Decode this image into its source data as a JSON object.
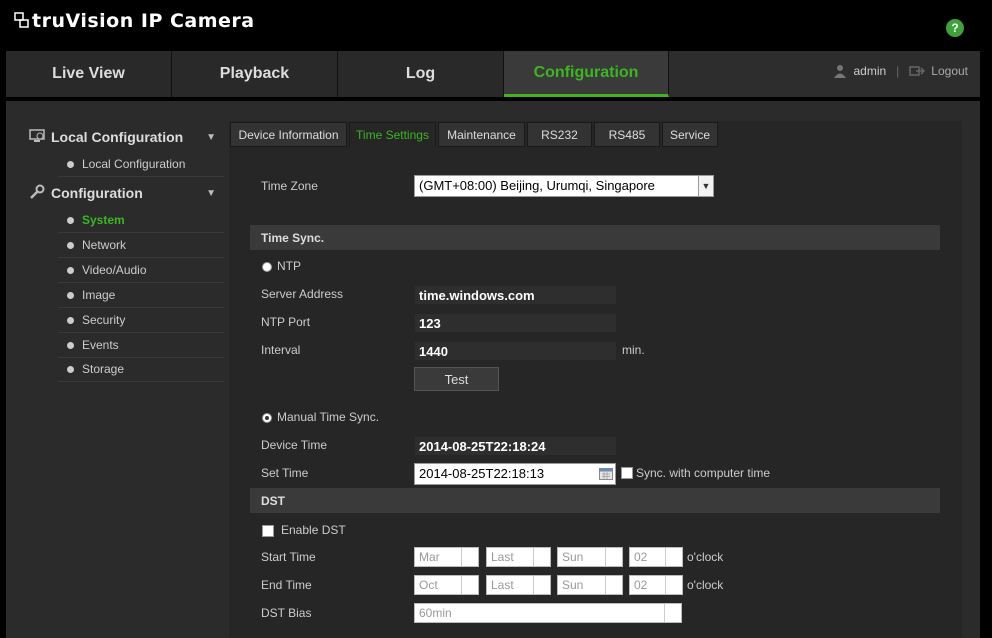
{
  "header": {
    "brand": "truVision  IP Camera",
    "help_icon": "help-icon"
  },
  "topnav": {
    "tabs": [
      {
        "label": "Live View"
      },
      {
        "label": "Playback"
      },
      {
        "label": "Log"
      },
      {
        "label": "Configuration",
        "active": true
      }
    ],
    "user": "admin",
    "logout": "Logout"
  },
  "sidebar": {
    "groups": [
      {
        "label": "Local Configuration",
        "icon": "monitor-icon",
        "items": [
          "Local Configuration"
        ]
      },
      {
        "label": "Configuration",
        "icon": "wrench-icon",
        "items": [
          "System",
          "Network",
          "Video/Audio",
          "Image",
          "Security",
          "Events",
          "Storage"
        ],
        "active": "System"
      }
    ]
  },
  "tabs": [
    {
      "label": "Device Information"
    },
    {
      "label": "Time Settings",
      "active": true
    },
    {
      "label": "Maintenance"
    },
    {
      "label": "RS232"
    },
    {
      "label": "RS485"
    },
    {
      "label": "Service"
    }
  ],
  "form": {
    "time_zone_label": "Time Zone",
    "time_zone_value": "(GMT+08:00) Beijing, Urumqi, Singapore",
    "time_sync_title": "Time Sync.",
    "ntp_label": "NTP",
    "server_address_label": "Server Address",
    "server_address_value": "time.windows.com",
    "ntp_port_label": "NTP Port",
    "ntp_port_value": "123",
    "interval_label": "Interval",
    "interval_value": "1440",
    "interval_unit": "min.",
    "test_button": "Test",
    "manual_label": "Manual Time Sync.",
    "device_time_label": "Device Time",
    "device_time_value": "2014-08-25T22:18:24",
    "set_time_label": "Set Time",
    "set_time_value": "2014-08-25T22:18:13",
    "sync_computer_label": "Sync. with computer time",
    "dst_title": "DST",
    "enable_dst_label": "Enable DST",
    "start_time_label": "Start Time",
    "start": {
      "month": "Mar",
      "week": "Last",
      "day": "Sun",
      "hour": "02"
    },
    "end_time_label": "End Time",
    "end": {
      "month": "Oct",
      "week": "Last",
      "day": "Sun",
      "hour": "02"
    },
    "oclock": "o'clock",
    "dst_bias_label": "DST Bias",
    "dst_bias_value": "60min"
  },
  "colors": {
    "accent": "#3cb521",
    "help": "#3fa13a"
  }
}
